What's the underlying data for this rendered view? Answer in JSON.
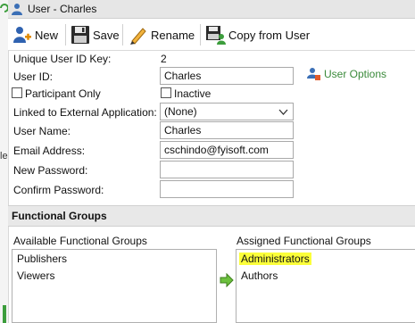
{
  "window": {
    "title": "User - Charles"
  },
  "toolbar": {
    "new_label": "New",
    "save_label": "Save",
    "rename_label": "Rename",
    "copy_label": "Copy from User"
  },
  "form": {
    "unique_key_label": "Unique User ID Key:",
    "unique_key_value": "2",
    "user_id_label": "User ID:",
    "user_id_value": "Charles",
    "participant_only_label": "Participant Only",
    "inactive_label": "Inactive",
    "linked_app_label": "Linked to External Application:",
    "linked_app_value": "(None)",
    "user_name_label": "User Name:",
    "user_name_value": "Charles",
    "email_label": "Email Address:",
    "email_value": "cschindo@fyisoft.com",
    "new_password_label": "New Password:",
    "confirm_password_label": "Confirm Password:"
  },
  "user_options": {
    "label": "User Options"
  },
  "functional_groups": {
    "section_title": "Functional Groups",
    "available_label": "Available Functional Groups",
    "assigned_label": "Assigned Functional Groups",
    "available": [
      "Publishers",
      "Viewers"
    ],
    "assigned": [
      "Administrators",
      "Authors"
    ]
  },
  "side_strip": {
    "fragment": "le"
  },
  "colors": {
    "highlight": "#fbff3a",
    "link_green": "#3a8a3a"
  }
}
